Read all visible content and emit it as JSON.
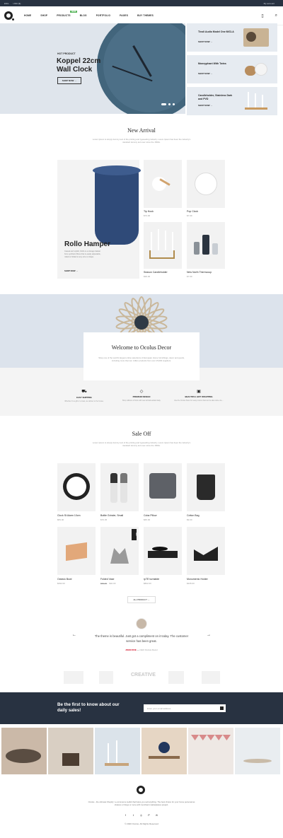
{
  "topbar": {
    "lang": "ENG",
    "currency": "USD ($)",
    "account": "My account"
  },
  "nav": {
    "items": [
      "HOME",
      "SHOP",
      "PRODUCTS",
      "BLOG",
      "PORTFOLIO",
      "PAGES",
      "BUY THEMES"
    ],
    "new_badge": "NEW"
  },
  "hero": {
    "kicker": "HOT PRODUCT",
    "title": "Koppel 22cm Wall Clock",
    "button": "SHOP NOW →"
  },
  "side_banners": [
    {
      "title": "Tivoli Audio Model One M/CLA",
      "link": "SHOP NOW →"
    },
    {
      "title": "Moneyphant With Twins",
      "link": "SHOP NOW →"
    },
    {
      "title": "Candleholder, Stainless Dark and PVD",
      "link": "SHOP NOW →"
    }
  ],
  "new_arrival": {
    "title": "New Arrival",
    "subtitle": "Lorem Ipsum is simply dummy text of the printing and typesetting industry. Lorem Ipsum has been the industry's standard dummy text ever since the 1500s.",
    "featured": {
      "title": "Rollo Hamper",
      "desc": "Casual and stylish, Rollo is a storage basket from synthetic fibres that is easily adjustable, rolled or folded to any size or shape.",
      "link": "SHOP NOW →"
    },
    "products": [
      {
        "name": "Tip Hook",
        "price": "$73.00"
      },
      {
        "name": "Pop Clock",
        "price": "$7.99"
      },
      {
        "name": "Season Candleholder",
        "price": "$99.00"
      },
      {
        "name": "New North Thermocup",
        "price": "$7.99"
      }
    ]
  },
  "welcome": {
    "title": "Welcome to Ocolus Decor",
    "desc": "Shop one of the world's largest online selections of European Home furnishings, decor and goods, including more than ten million products from over 15,000 suppliers."
  },
  "features": [
    {
      "icon": "truck",
      "title": "EASY SHIPPING",
      "desc": "Whether it's a gift or a treat, we deliver to the house."
    },
    {
      "icon": "diamond",
      "title": "PREMIUM DESIGN",
      "desc": "Shop millions of finds with new arrivals added daily."
    },
    {
      "icon": "gift",
      "title": "BEAUTIFUL GIFT WRAPPING",
      "desc": "Use the Ocolus Store for easy returns that can be also done via ..."
    }
  ],
  "sale": {
    "title": "Sale Off",
    "subtitle": "Lorem Ipsum is simply dummy text of the printing and typesetting industry. Lorem Ipsum has been the industry's standard dummy text ever since the 1500s.",
    "products": [
      {
        "name": "Clock St Alarm 10cm",
        "price": "$83.00",
        "old": ""
      },
      {
        "name": "Bottle Grinder, Small",
        "price": "$70.45",
        "old": ""
      },
      {
        "name": "Coba Pillow",
        "price": "$65.00",
        "old": ""
      },
      {
        "name": "Cotton Bag",
        "price": "$9.00",
        "old": ""
      },
      {
        "name": "Octavio Bowl",
        "price": "$392.00",
        "old": ""
      },
      {
        "name": "Folded Vase",
        "price": "$42.00",
        "old": "$55.00",
        "badge": "SALE"
      },
      {
        "name": "rpTE turntable",
        "price": "$802.00",
        "old": ""
      },
      {
        "name": "Monumento Holder",
        "price": "$345.00",
        "old": ""
      }
    ],
    "button": "ALL PRODUCT →"
  },
  "testimonial": {
    "quote": "The theme is beautiful. Just got a compliment on it today. The customer service has been great.",
    "author": "JOHN DOE",
    "role": "CEO Ocolus Decor"
  },
  "brands": [
    "",
    "",
    "CREATIVE",
    "",
    ""
  ],
  "newsletter": {
    "title": "Be the first to know about our daily sales!",
    "placeholder": "Enter your email address"
  },
  "footer": {
    "desc": "Ocolus - the ultimate Shopify / e-commerce toolkit that helps you sell anything. The best choice for your home personal as shelves or blogs or more with merchant marketplaces project.",
    "social": [
      "f",
      "t",
      "◎",
      "P",
      "✉"
    ],
    "copyright": "© 2020 Ocolus. All Rights Reserved"
  }
}
